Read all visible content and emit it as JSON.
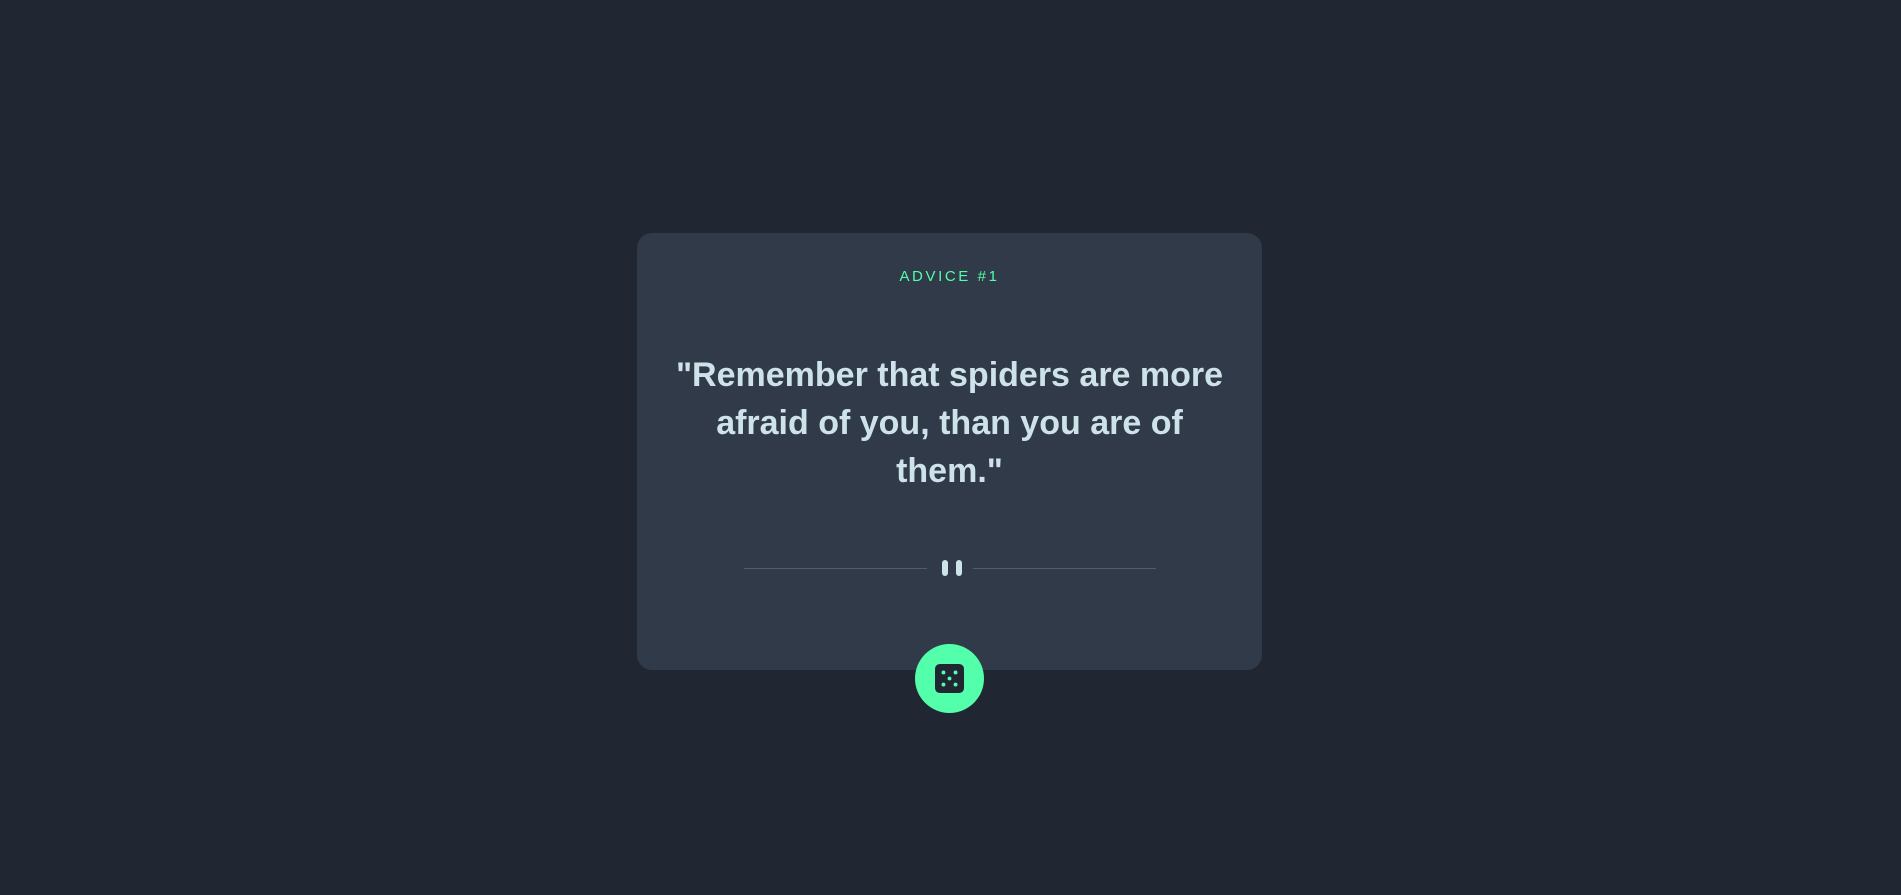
{
  "card": {
    "label": "ADVICE #1",
    "quote": "\"Remember that spiders are more afraid of you, than you are of them.\""
  },
  "divider": {
    "icon": "pause-icon"
  },
  "dice_button": {
    "icon": "dice-icon"
  },
  "colors": {
    "background": "#202733",
    "card": "#313a48",
    "accent": "#53ffaa",
    "text": "#cee3e9",
    "divider_line": "#4e5d73"
  }
}
